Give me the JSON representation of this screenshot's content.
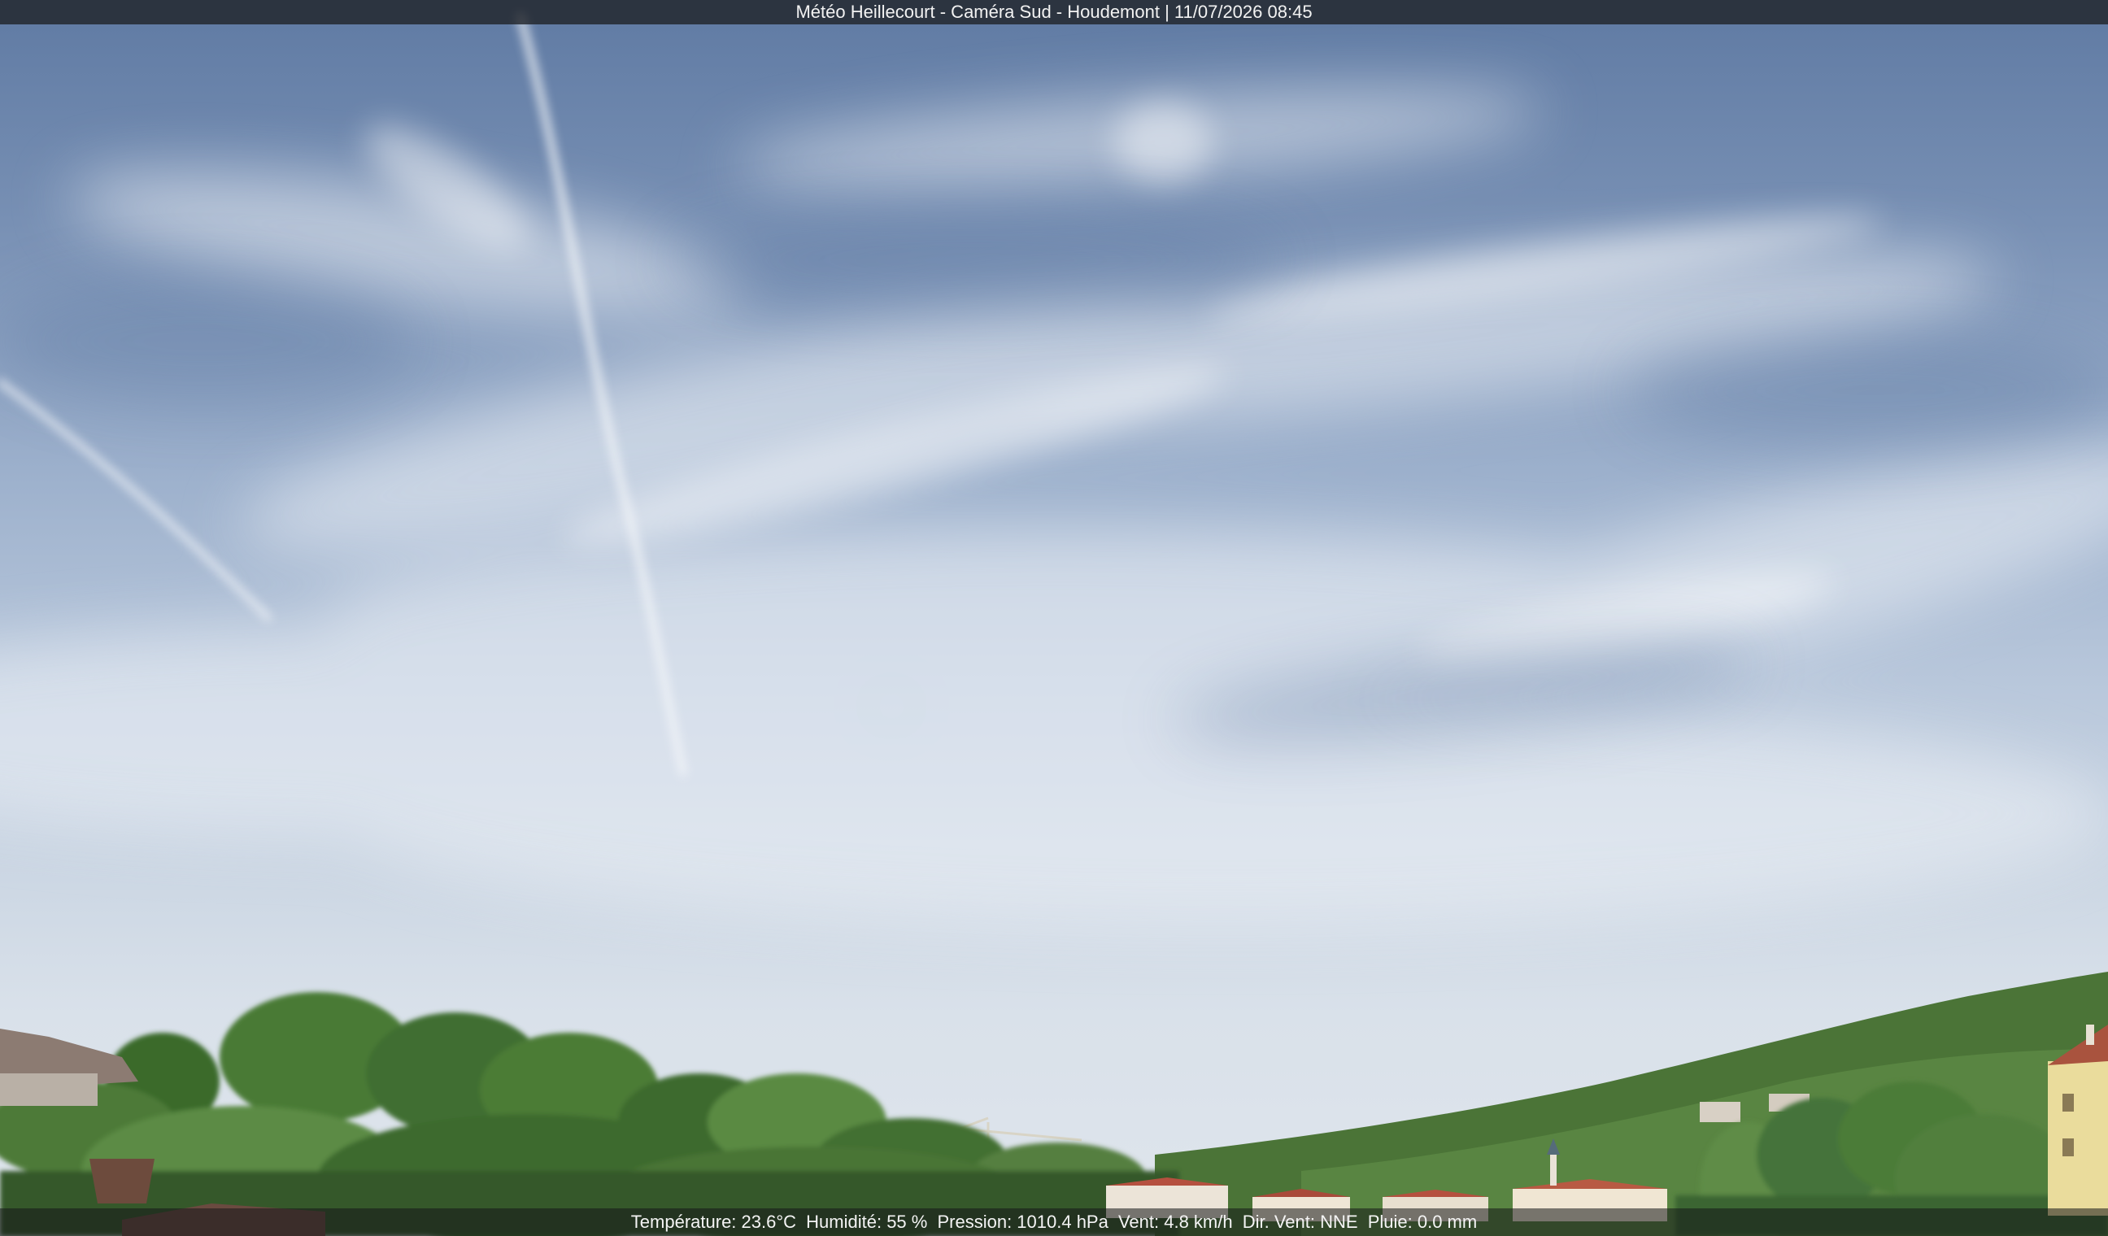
{
  "overlay": {
    "title": "Météo Heillecourt - Caméra Sud - Houdemont | 11/07/2026 08:45"
  },
  "weather": {
    "temperature": "Température: 23.6°C",
    "humidity": "Humidité: 55 %",
    "pressure": "Pression: 1010.4 hPa",
    "wind_speed": "Vent: 4.8 km/h",
    "wind_direction": "Dir. Vent: NNE",
    "rain": "Pluie: 0.0 mm"
  },
  "colors": {
    "sky_top": "#5f7aa3",
    "sky_horizon": "#dfe5ec",
    "vegetation": "#3f6b2c",
    "roof": "#b5503f"
  }
}
